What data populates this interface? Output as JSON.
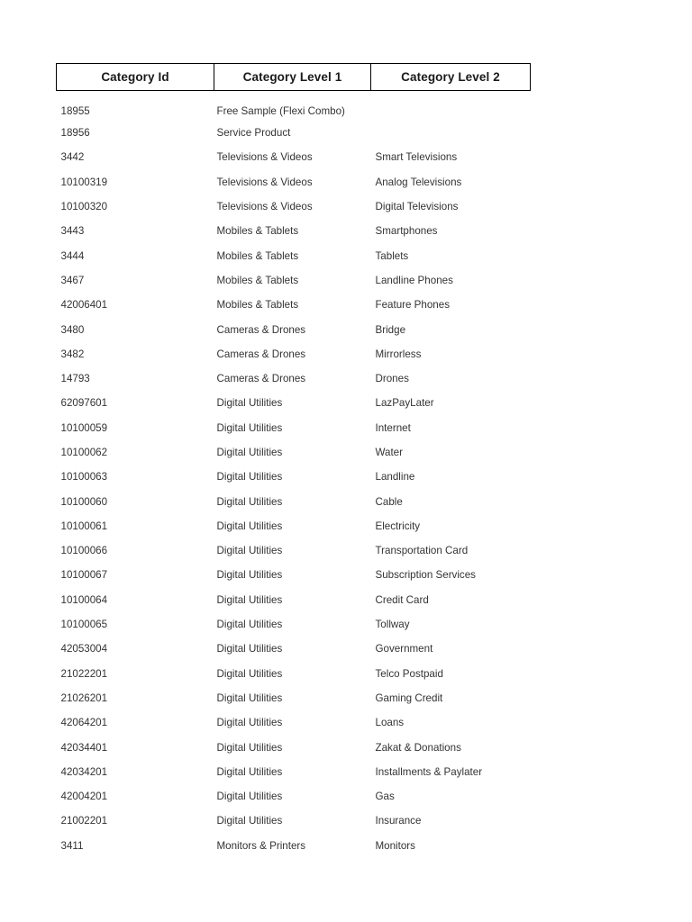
{
  "table": {
    "columns": [
      {
        "key": "category_id",
        "label": "Category Id"
      },
      {
        "key": "category_level_1",
        "label": "Category Level 1"
      },
      {
        "key": "category_level_2",
        "label": "Category Level 2"
      }
    ],
    "rows": [
      {
        "category_id": "18955",
        "category_level_1": "Free Sample (Flexi Combo)",
        "category_level_2": ""
      },
      {
        "category_id": "18956",
        "category_level_1": "Service Product",
        "category_level_2": ""
      },
      {
        "category_id": "3442",
        "category_level_1": "Televisions & Videos",
        "category_level_2": "Smart Televisions"
      },
      {
        "category_id": "10100319",
        "category_level_1": "Televisions & Videos",
        "category_level_2": "Analog Televisions"
      },
      {
        "category_id": "10100320",
        "category_level_1": "Televisions & Videos",
        "category_level_2": "Digital Televisions"
      },
      {
        "category_id": "3443",
        "category_level_1": "Mobiles & Tablets",
        "category_level_2": "Smartphones"
      },
      {
        "category_id": "3444",
        "category_level_1": "Mobiles & Tablets",
        "category_level_2": "Tablets"
      },
      {
        "category_id": "3467",
        "category_level_1": "Mobiles & Tablets",
        "category_level_2": "Landline Phones"
      },
      {
        "category_id": "42006401",
        "category_level_1": "Mobiles & Tablets",
        "category_level_2": "Feature Phones"
      },
      {
        "category_id": "3480",
        "category_level_1": "Cameras & Drones",
        "category_level_2": "Bridge"
      },
      {
        "category_id": "3482",
        "category_level_1": "Cameras & Drones",
        "category_level_2": "Mirrorless"
      },
      {
        "category_id": "14793",
        "category_level_1": "Cameras & Drones",
        "category_level_2": "Drones"
      },
      {
        "category_id": "62097601",
        "category_level_1": "Digital Utilities",
        "category_level_2": "LazPayLater"
      },
      {
        "category_id": "10100059",
        "category_level_1": "Digital Utilities",
        "category_level_2": "Internet"
      },
      {
        "category_id": "10100062",
        "category_level_1": "Digital Utilities",
        "category_level_2": "Water"
      },
      {
        "category_id": "10100063",
        "category_level_1": "Digital Utilities",
        "category_level_2": "Landline"
      },
      {
        "category_id": "10100060",
        "category_level_1": "Digital Utilities",
        "category_level_2": "Cable"
      },
      {
        "category_id": "10100061",
        "category_level_1": "Digital Utilities",
        "category_level_2": "Electricity"
      },
      {
        "category_id": "10100066",
        "category_level_1": "Digital Utilities",
        "category_level_2": "Transportation Card"
      },
      {
        "category_id": "10100067",
        "category_level_1": "Digital Utilities",
        "category_level_2": "Subscription Services"
      },
      {
        "category_id": "10100064",
        "category_level_1": "Digital Utilities",
        "category_level_2": "Credit Card"
      },
      {
        "category_id": "10100065",
        "category_level_1": "Digital Utilities",
        "category_level_2": "Tollway"
      },
      {
        "category_id": "42053004",
        "category_level_1": "Digital Utilities",
        "category_level_2": "Government"
      },
      {
        "category_id": "21022201",
        "category_level_1": "Digital Utilities",
        "category_level_2": "Telco Postpaid"
      },
      {
        "category_id": "21026201",
        "category_level_1": "Digital Utilities",
        "category_level_2": "Gaming Credit"
      },
      {
        "category_id": "42064201",
        "category_level_1": "Digital Utilities",
        "category_level_2": "Loans"
      },
      {
        "category_id": "42034401",
        "category_level_1": "Digital Utilities",
        "category_level_2": "Zakat & Donations"
      },
      {
        "category_id": "42034201",
        "category_level_1": "Digital Utilities",
        "category_level_2": "Installments & Paylater"
      },
      {
        "category_id": "42004201",
        "category_level_1": "Digital Utilities",
        "category_level_2": "Gas"
      },
      {
        "category_id": "21002201",
        "category_level_1": "Digital Utilities",
        "category_level_2": "Insurance"
      },
      {
        "category_id": "3411",
        "category_level_1": "Monitors & Printers",
        "category_level_2": "Monitors"
      }
    ]
  },
  "colors": {
    "page_background": "#ffffff",
    "header_text": "#1a1a1a",
    "body_text": "#333333",
    "border": "#000000"
  }
}
